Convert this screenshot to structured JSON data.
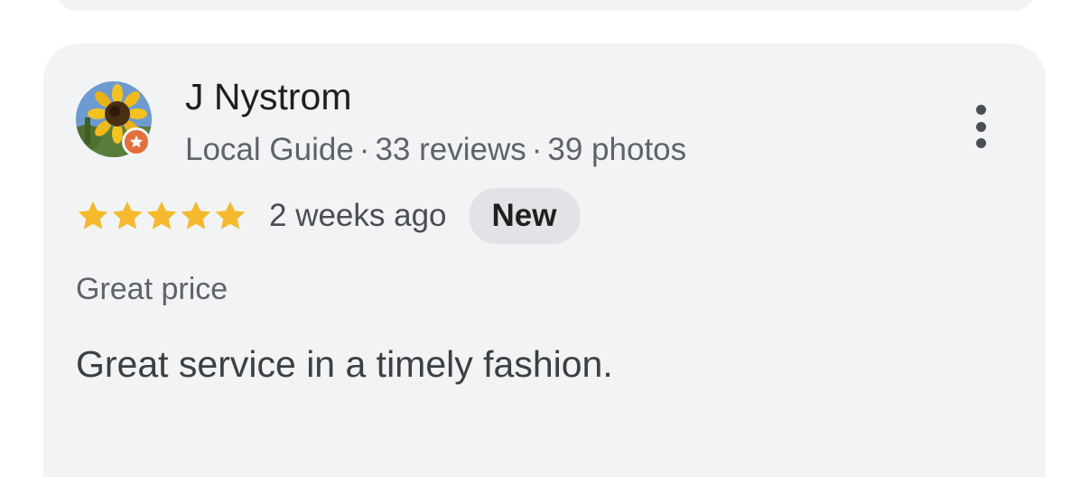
{
  "review": {
    "reviewer_name": "J Nystrom",
    "badge_icon": "star-icon",
    "meta": {
      "role": "Local Guide",
      "separator": "·",
      "reviews": "33 reviews",
      "photos": "39 photos"
    },
    "rating": 5,
    "rating_max": 5,
    "star_color": "#f4b92e",
    "time_ago": "2 weeks ago",
    "new_label": "New",
    "tag": "Great price",
    "text": "Great service in a timely fashion."
  },
  "menu_icon": "more-vertical-icon",
  "colors": {
    "card_background": "#f2f3f5",
    "badge_background": "#e3703a",
    "new_badge_background": "#e1e3e6"
  }
}
